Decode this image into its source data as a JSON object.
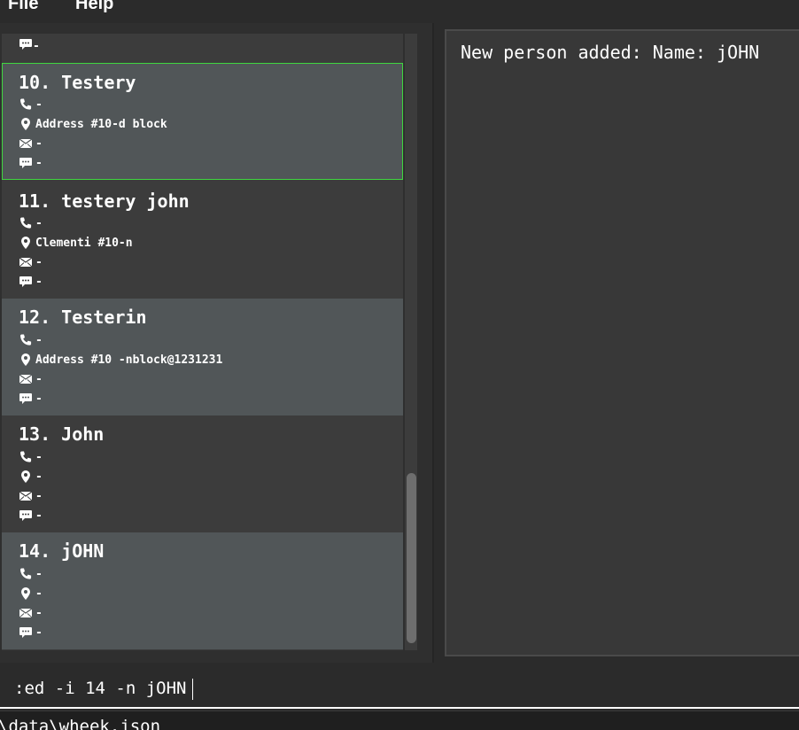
{
  "menu": {
    "file_label": "File",
    "help_label": "Help"
  },
  "partial_card": {
    "remark": "-"
  },
  "persons": [
    {
      "index_name": "10. Testery",
      "phone": "-",
      "address": "Address #10-d block",
      "email": "-",
      "remark": "-"
    },
    {
      "index_name": "11. testery john",
      "phone": "-",
      "address": "Clementi #10-n",
      "email": "-",
      "remark": "-"
    },
    {
      "index_name": "12. Testerin",
      "phone": "-",
      "address": "Address #10 -nblock@1231231",
      "email": "-",
      "remark": "-"
    },
    {
      "index_name": "13. John",
      "phone": "-",
      "address": "-",
      "email": "-",
      "remark": "-"
    },
    {
      "index_name": "14. jOHN",
      "phone": "-",
      "address": "-",
      "email": "-",
      "remark": "-"
    }
  ],
  "result_display": {
    "message": "New person added: Name: jOHN"
  },
  "command_box": {
    "value": ":ed -i 14 -n jOHN"
  },
  "status_bar": {
    "path": "\\data\\wheek.json"
  },
  "colors": {
    "selected_border": "#3fd63f",
    "card_light": "#515658",
    "card_dark": "#3c3c3c"
  }
}
